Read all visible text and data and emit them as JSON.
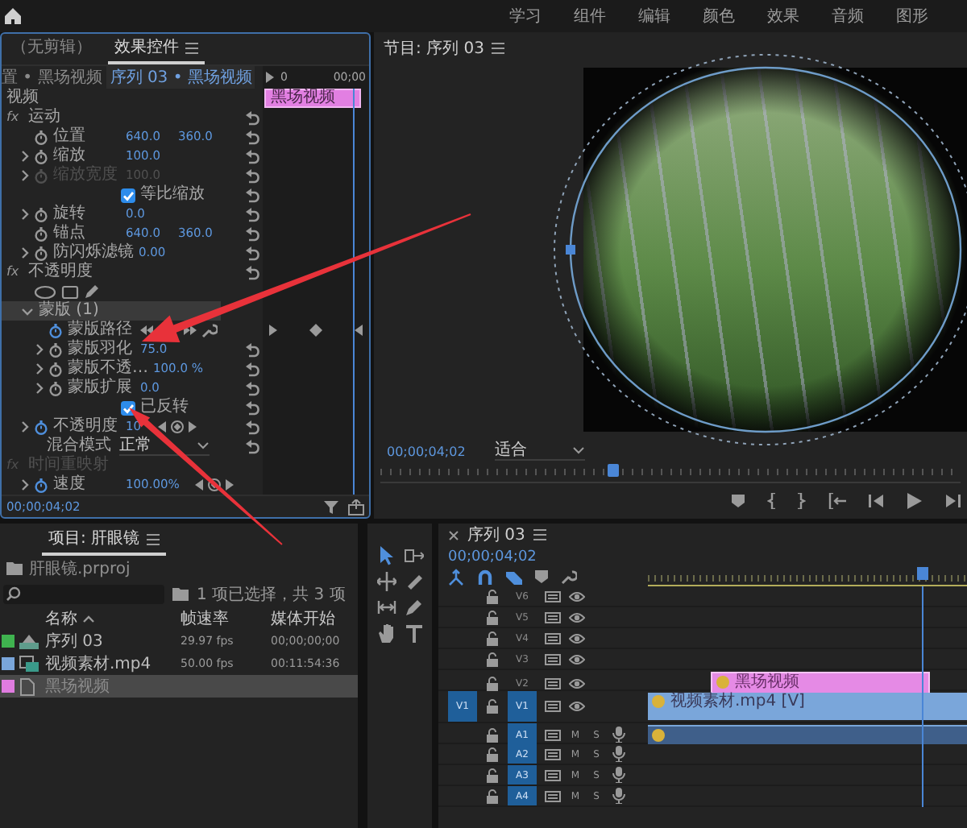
{
  "menu_bar": {
    "items": [
      {
        "label": "学习",
        "selected": false
      },
      {
        "label": "组件",
        "selected": false
      },
      {
        "label": "编辑",
        "selected": false
      },
      {
        "label": "颜色",
        "selected": false
      },
      {
        "label": "效果",
        "selected": false
      },
      {
        "label": "音频",
        "selected": false
      },
      {
        "label": "图形",
        "selected": false
      }
    ]
  },
  "effect_controls": {
    "tabs": [
      {
        "label": "（无剪辑）",
        "selected": false
      },
      {
        "label": "效果控件",
        "selected": true
      }
    ],
    "source": "置 • 黑场视频",
    "sequence": "序列 03 • 黑场视频",
    "ruler_start": "0",
    "ruler_end": "00;00",
    "section": "视频",
    "clip": "黑场视频",
    "rows": [
      {
        "kind": "group",
        "badge": "fx",
        "label": "运动",
        "disabled": false,
        "reset": true,
        "children": [
          {
            "kind": "param",
            "label": "位置",
            "values": [
              "640.0",
              "360.0"
            ],
            "expandable": false,
            "animated": false,
            "disabled": false,
            "reset": true,
            "nav": false
          },
          {
            "kind": "param",
            "label": "缩放",
            "values": [
              "100.0"
            ],
            "expandable": true,
            "animated": false,
            "disabled": false,
            "reset": true,
            "nav": false
          },
          {
            "kind": "param",
            "label": "缩放宽度",
            "values": [
              "100.0"
            ],
            "expandable": true,
            "animated": false,
            "disabled": true,
            "reset": true,
            "nav": false
          },
          {
            "kind": "checkbox",
            "label": "等比缩放",
            "checked": true,
            "reset": true
          },
          {
            "kind": "param",
            "label": "旋转",
            "values": [
              "0.0"
            ],
            "expandable": true,
            "animated": false,
            "disabled": false,
            "reset": true,
            "nav": false
          },
          {
            "kind": "param",
            "label": "锚点",
            "values": [
              "640.0",
              "360.0"
            ],
            "expandable": false,
            "animated": false,
            "disabled": false,
            "reset": true,
            "nav": false
          },
          {
            "kind": "param",
            "label": "防闪烁滤镜",
            "values": [
              "0.00"
            ],
            "expandable": true,
            "animated": false,
            "disabled": false,
            "reset": true,
            "nav": false
          }
        ]
      },
      {
        "kind": "group",
        "badge": "fx",
        "label": "不透明度",
        "disabled": false,
        "reset": true,
        "children": [
          {
            "kind": "shapes"
          },
          {
            "kind": "mask",
            "label": "蒙版 (1)",
            "expanded": true,
            "children": [
              {
                "kind": "path",
                "label": "蒙版路径",
                "animated": true
              },
              {
                "kind": "param",
                "label": "蒙版羽化",
                "values": [
                  "75.0"
                ],
                "expandable": true,
                "animated": false,
                "disabled": false,
                "reset": true,
                "nav": false
              },
              {
                "kind": "param",
                "label": "蒙版不透…",
                "values": [
                  "100.0 %"
                ],
                "expandable": true,
                "animated": false,
                "disabled": false,
                "reset": true,
                "nav": false
              },
              {
                "kind": "param",
                "label": "蒙版扩展",
                "values": [
                  "0.0"
                ],
                "expandable": true,
                "animated": false,
                "disabled": false,
                "reset": true,
                "nav": false
              },
              {
                "kind": "checkbox",
                "label": "已反转",
                "checked": true,
                "reset": true
              }
            ]
          },
          {
            "kind": "param",
            "label": "不透明度",
            "values": [
              "10"
            ],
            "expandable": true,
            "animated": true,
            "disabled": false,
            "reset": true,
            "nav": true
          },
          {
            "kind": "dropdown",
            "label": "混合模式",
            "value": "正常",
            "reset": true
          }
        ]
      },
      {
        "kind": "group",
        "badge": "fx",
        "label": "时间重映射",
        "disabled": true,
        "reset": false,
        "children": [
          {
            "kind": "param",
            "label": "速度",
            "values": [
              "100.00%"
            ],
            "expandable": true,
            "animated": true,
            "disabled": false,
            "reset": false,
            "nav": true
          }
        ]
      }
    ],
    "timecode": "00;00;04;02"
  },
  "program_monitor": {
    "title": "节目: 序列 03",
    "timecode": "00;00;04;02",
    "zoom": "适合",
    "playhead": {
      "level": 0.4
    }
  },
  "project": {
    "tab": "项目: 肝眼镜",
    "file": "肝眼镜.prproj",
    "selection": "1 项已选择，共 3 项",
    "columns": [
      "名称",
      "帧速率",
      "媒体开始"
    ],
    "items": [
      {
        "kind": "sequence",
        "name": "序列 03",
        "fps": "29.97 fps",
        "start": "00;00;00;00",
        "color": "#3fb34f",
        "selected": false
      },
      {
        "kind": "video",
        "name": "视频素材.mp4",
        "fps": "50.00 fps",
        "start": "00:11:54:36",
        "color": "#7aa6da",
        "selected": false
      },
      {
        "kind": "graphic",
        "name": "黑场视频",
        "color": "#e07ce0",
        "selected": true
      }
    ]
  },
  "timeline": {
    "title": "序列 03",
    "timecode": "00;00;04;02",
    "playhead": {
      "level": 0.86
    },
    "tracks": [
      {
        "kind": "video",
        "label": "V6",
        "targeted": false
      },
      {
        "kind": "video",
        "label": "V5",
        "targeted": false
      },
      {
        "kind": "video",
        "label": "V4",
        "targeted": false
      },
      {
        "kind": "video",
        "label": "V3",
        "targeted": false
      },
      {
        "kind": "video",
        "label": "V2",
        "targeted": false,
        "clips": [
          {
            "kind": "graphic",
            "label": "黑场视频",
            "color": "#e58ae5"
          }
        ]
      },
      {
        "kind": "video",
        "label": "V1",
        "source": "V1",
        "targeted": true,
        "clips": [
          {
            "kind": "video",
            "label": "视频素材.mp4 [V]",
            "color": "#7aa6da"
          }
        ]
      },
      {
        "kind": "audio",
        "label": "A1",
        "targeted": true,
        "buttons": [
          "M",
          "S"
        ],
        "clips": [
          {
            "kind": "audio",
            "color": "#3f5f8a"
          }
        ]
      },
      {
        "kind": "audio",
        "label": "A2",
        "targeted": true,
        "buttons": [
          "M",
          "S"
        ]
      },
      {
        "kind": "audio",
        "label": "A3",
        "targeted": true,
        "buttons": [
          "M",
          "S"
        ]
      },
      {
        "kind": "audio",
        "label": "A4",
        "targeted": true,
        "buttons": [
          "M",
          "S"
        ]
      }
    ]
  }
}
